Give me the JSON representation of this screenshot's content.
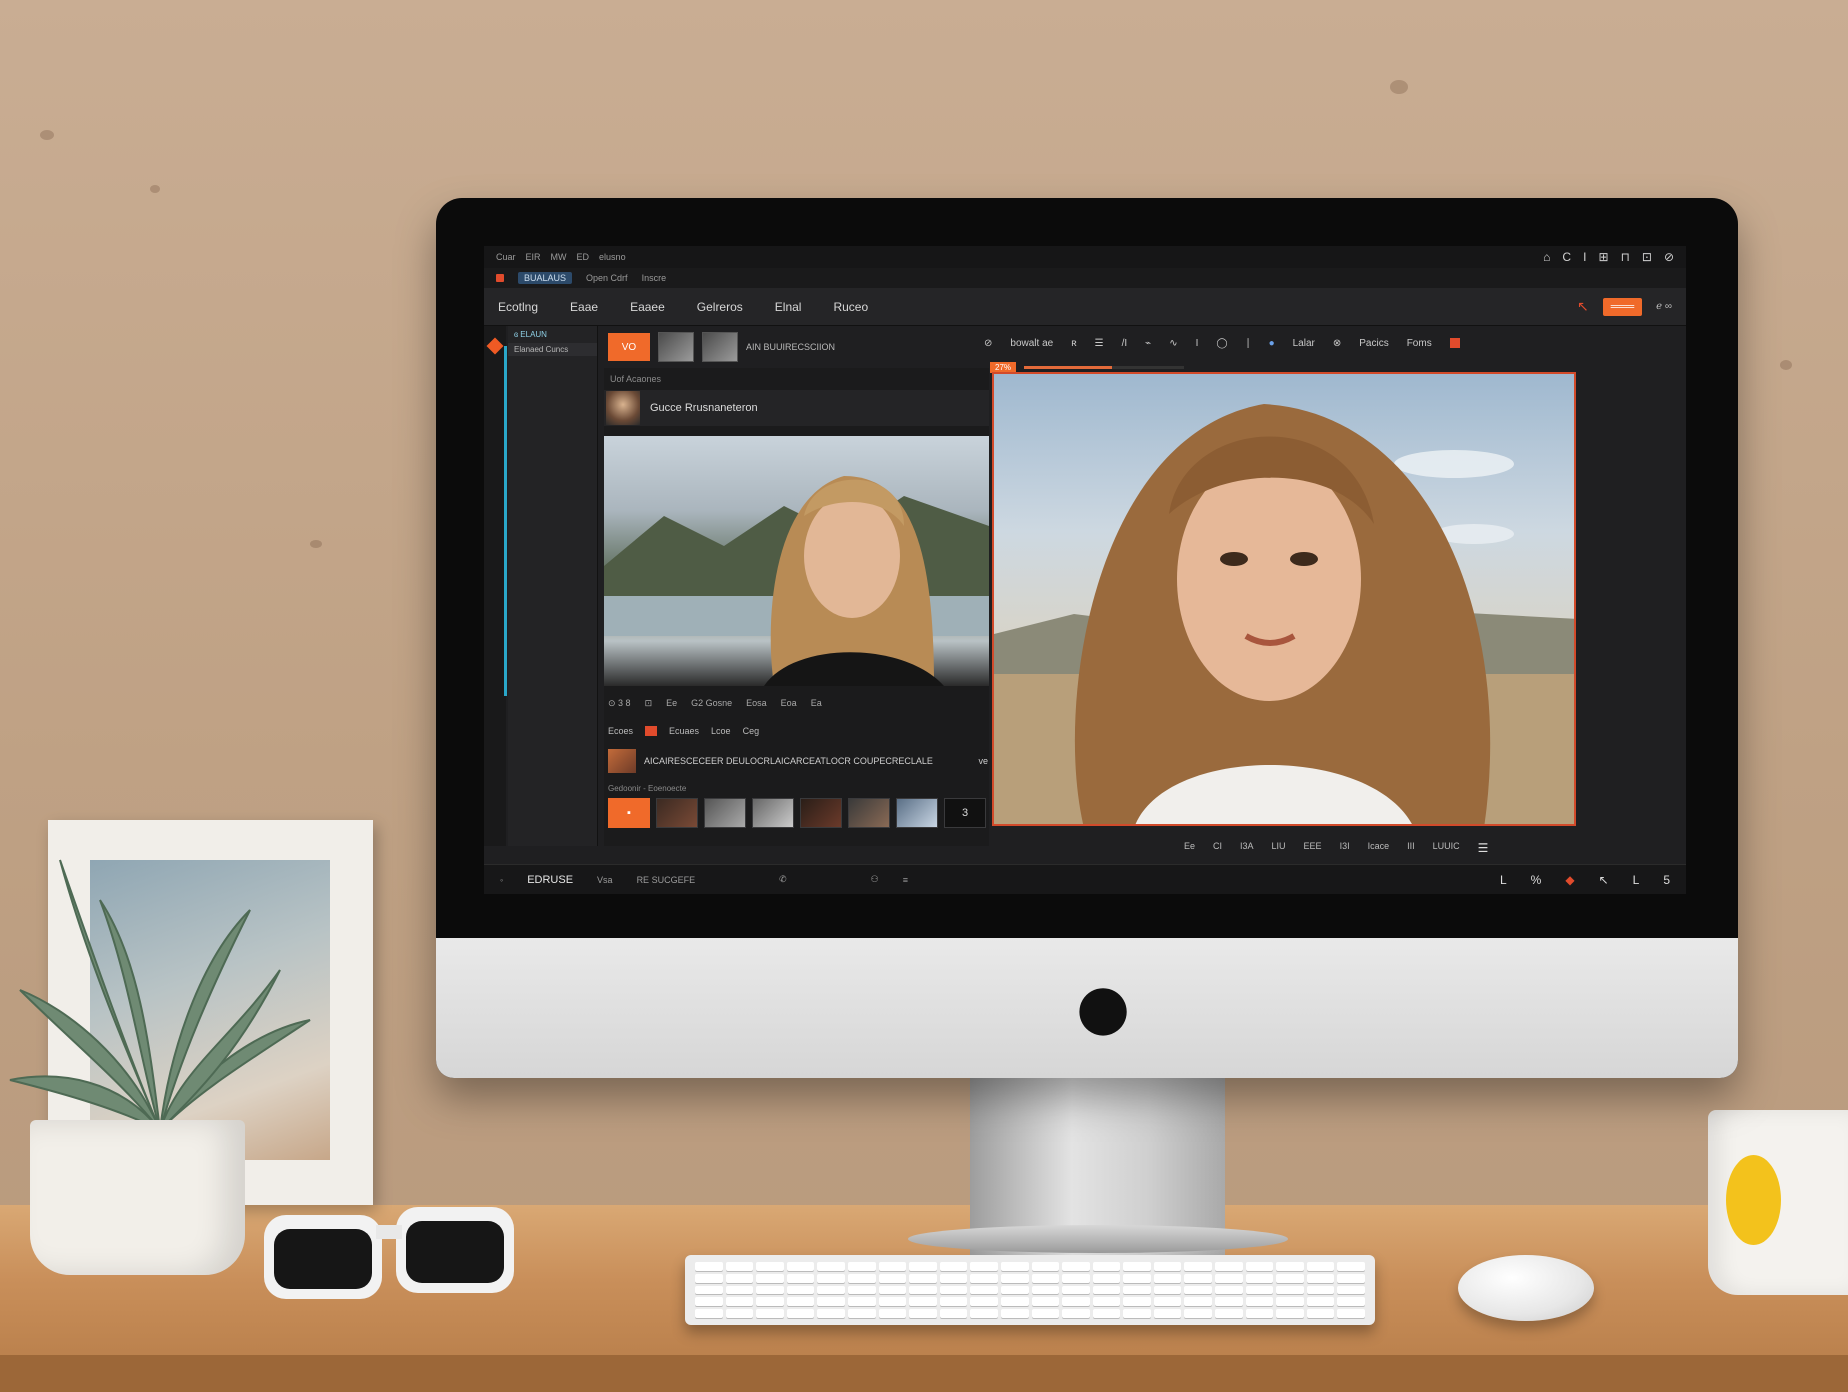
{
  "app": {
    "title_bar": {
      "labels": [
        "Cuar",
        "EIR",
        "MW",
        "ED",
        "elusno"
      ],
      "window_controls": [
        "⌂",
        "C",
        "I",
        "⊞",
        "⊓",
        "⊡",
        "⊘"
      ]
    },
    "sub_bar": {
      "chip": "BUALAUS",
      "labels": [
        "Open Cdrf",
        "Inscre"
      ]
    },
    "menu": {
      "items": [
        "Ecotlng",
        "Eaae",
        "Eaaee",
        "Gelreros",
        "Elnal",
        "Ruceo"
      ],
      "right_orange": "═══",
      "right_text": "ℯ ∞"
    },
    "layers": {
      "label_top": "ɞ ELAUN",
      "label_item": "Elanaed Cuncs"
    },
    "tabs": {
      "orange": "VO",
      "title": "AIN BUUIRECSCIION"
    },
    "source_panel": {
      "label": "Uof Acaones",
      "name": "Gucce Rrusnaneteron",
      "controls_row": [
        "⊙ 3 8",
        "⊡",
        "Ee",
        "G2 Gosne",
        "Eosa",
        "Eoa",
        "Ea"
      ],
      "controls_row2": [
        "Ecoes",
        "Ecuaes",
        "Lcoe",
        "Ceg"
      ],
      "description": "AICAIRESCECEER DEULOCRLAICARCEATLOCR COUPECRECLALE",
      "description_suffix": "ve",
      "filmstrip_label": "Gedoonir - Eoenoecte",
      "filmstrip": [
        "▪",
        "",
        "",
        "",
        "",
        "",
        "",
        "3"
      ]
    },
    "main_toolbar": {
      "items": [
        "⊘",
        "bowalt ae",
        "ʀ",
        "☰",
        "/I",
        "⌁",
        "∿",
        "I",
        "◯",
        "∣",
        "●",
        "Lalar",
        "⊗",
        "Pacics",
        "Foms"
      ],
      "zoom_badge": "27%",
      "progress": 0.55
    },
    "canvas_controls": [
      "Ee",
      "CI",
      "I3A",
      "LIU",
      "EEE",
      "I3I",
      "Icace",
      "III",
      "LUUIC"
    ],
    "status_bar": {
      "mode": "EDRUSE",
      "labels": [
        "Vsa",
        "RE SUCGEFE"
      ],
      "right": [
        "L",
        "%",
        "◆",
        "↖",
        "L",
        "5"
      ]
    },
    "colors": {
      "accent_orange": "#f06a2a",
      "accent_red": "#d24a2a",
      "accent_cyan": "#2aa7c9",
      "ui_dark": "#1f1f21"
    }
  }
}
